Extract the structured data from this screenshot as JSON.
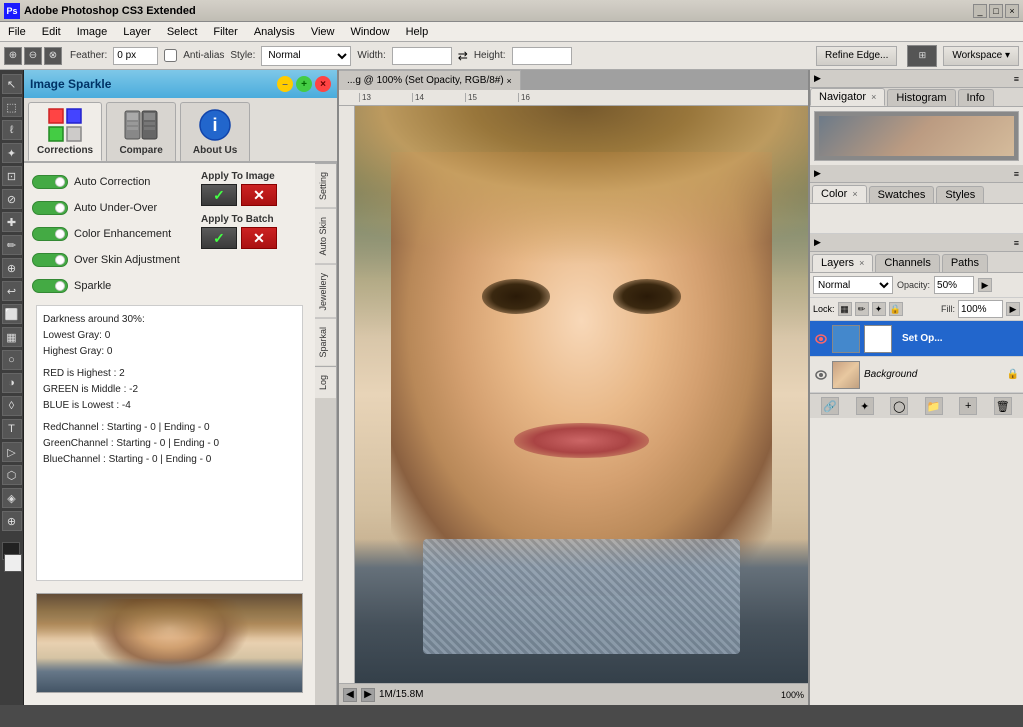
{
  "titlebar": {
    "app_name": "Adobe Photoshop CS3 Extended",
    "ps_icon": "Ps"
  },
  "menubar": {
    "items": [
      "File",
      "Edit",
      "Image",
      "Layer",
      "Select",
      "Filter",
      "Analysis",
      "View",
      "Window",
      "Help"
    ]
  },
  "optionsbar": {
    "style_label": "Style:",
    "style_value": "Normal",
    "width_label": "Width:",
    "height_label": "Height:",
    "feather_label": "Feather:",
    "feather_value": "0 px",
    "anti_alias_label": "Anti-alias",
    "refine_edge_btn": "Refine Edge...",
    "workspace_btn": "Workspace ▾"
  },
  "plugin": {
    "title": "Image Sparkle",
    "tabs": [
      {
        "id": "corrections",
        "label": "Corrections",
        "active": true
      },
      {
        "id": "compare",
        "label": "Compare"
      },
      {
        "id": "about",
        "label": "About Us"
      }
    ],
    "toggles": [
      {
        "id": "auto_correction",
        "label": "Auto Correction",
        "on": true
      },
      {
        "id": "auto_under_over",
        "label": "Auto Under-Over",
        "on": true
      },
      {
        "id": "color_enhancement",
        "label": "Color Enhancement",
        "on": true
      },
      {
        "id": "over_skin",
        "label": "Over Skin Adjustment",
        "on": true
      },
      {
        "id": "sparkle",
        "label": "Sparkle",
        "on": true
      }
    ],
    "apply_image": {
      "label": "Apply To Image",
      "check_label": "✓",
      "x_label": "✕"
    },
    "apply_batch": {
      "label": "Apply To Batch",
      "check_label": "✓",
      "x_label": "✕"
    },
    "stats": {
      "darkness": "Darkness around 30%:",
      "lowest_gray": "Lowest Gray: 0",
      "highest_gray": "Highest Gray: 0",
      "empty_line": "",
      "red": "RED is Highest : 2",
      "green": "GREEN is Middle : -2",
      "blue": "BLUE is Lowest : -4",
      "empty_line2": "",
      "red_channel": "RedChannel : Starting - 0 | Ending - 0",
      "green_channel": "GreenChannel : Starting - 0 | Ending - 0",
      "blue_channel": "BlueChannel : Starting - 0 | Ending - 0"
    },
    "side_tabs": [
      "Setting",
      "Auto Skin",
      "Jewellery",
      "Sparkal",
      "Log"
    ]
  },
  "canvas": {
    "tab_title": "...g @ 100% (Set Opacity, RGB/8#)",
    "ruler_marks": [
      "13",
      "14",
      "15",
      "16"
    ]
  },
  "statusbar": {
    "info": "1M/15.8M"
  },
  "right_panel": {
    "top_tabs": [
      {
        "label": "Navigator",
        "active": true,
        "closeable": true
      },
      {
        "label": "Histogram"
      },
      {
        "label": "Info"
      }
    ],
    "color_tabs": [
      {
        "label": "Color",
        "active": true,
        "closeable": true
      },
      {
        "label": "Swatches"
      },
      {
        "label": "Styles"
      }
    ],
    "layers_tabs": [
      {
        "label": "Layers",
        "active": true,
        "closeable": true
      },
      {
        "label": "Channels"
      },
      {
        "label": "Paths"
      }
    ],
    "layers": {
      "blend_mode": "Normal",
      "opacity_label": "Opacity:",
      "opacity_value": "50%",
      "fill_label": "Fill:",
      "fill_value": "100%",
      "lock_label": "Lock:",
      "items": [
        {
          "name": "Set Op...",
          "type": "adjustment",
          "visible": true,
          "active": true
        },
        {
          "name": "Background",
          "type": "normal",
          "visible": true,
          "locked": true,
          "active": false
        }
      ]
    }
  }
}
